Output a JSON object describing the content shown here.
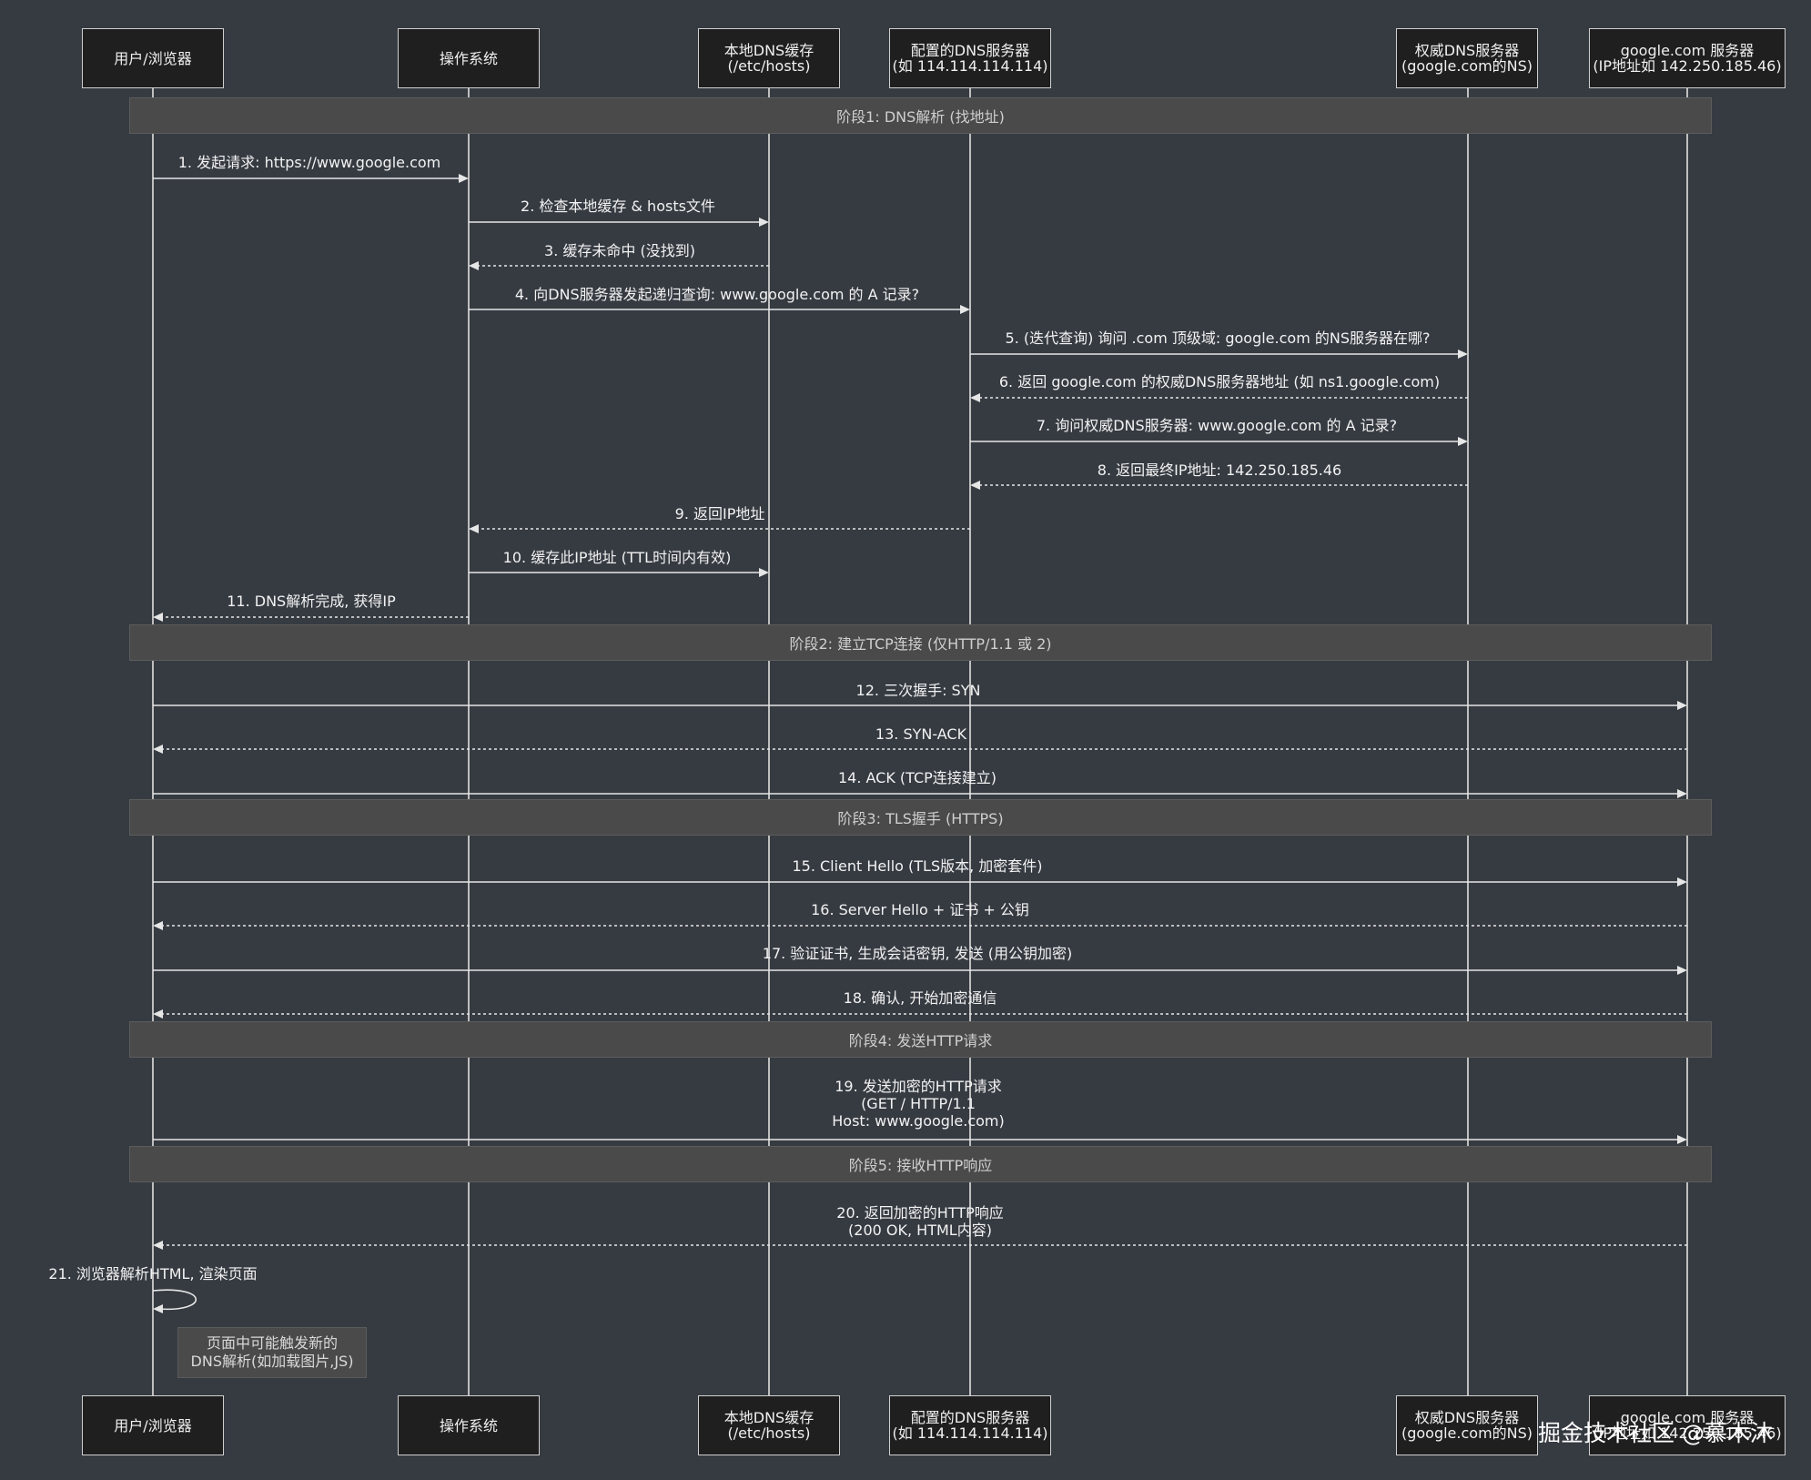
{
  "participants": [
    {
      "id": "user",
      "label": "用户/浏览器"
    },
    {
      "id": "os",
      "label": "操作系统"
    },
    {
      "id": "local",
      "label": "本地DNS缓存\n(/etc/hosts)"
    },
    {
      "id": "dns",
      "label": "配置的DNS服务器\n(如 114.114.114.114)"
    },
    {
      "id": "auth",
      "label": "权威DNS服务器\n(google.com的NS)"
    },
    {
      "id": "google",
      "label": "google.com 服务器\n(IP地址如 142.250.185.46)"
    }
  ],
  "phases": [
    {
      "label": "阶段1: DNS解析 (找地址)"
    },
    {
      "label": "阶段2: 建立TCP连接 (仅HTTP/1.1 或 2)"
    },
    {
      "label": "阶段3: TLS握手 (HTTPS)"
    },
    {
      "label": "阶段4: 发送HTTP请求"
    },
    {
      "label": "阶段5: 接收HTTP响应"
    }
  ],
  "messages": [
    {
      "label": "1. 发起请求: https://www.google.com",
      "from": "user",
      "to": "os",
      "dashed": false
    },
    {
      "label": "2. 检查本地缓存 & hosts文件",
      "from": "os",
      "to": "local",
      "dashed": false
    },
    {
      "label": "3. 缓存未命中 (没找到)",
      "from": "local",
      "to": "os",
      "dashed": true
    },
    {
      "label": "4. 向DNS服务器发起递归查询: www.google.com 的 A 记录?",
      "from": "os",
      "to": "dns",
      "dashed": false
    },
    {
      "label": "5. (迭代查询) 询问 .com 顶级域: google.com 的NS服务器在哪?",
      "from": "dns",
      "to": "auth",
      "dashed": false
    },
    {
      "label": "6. 返回 google.com 的权威DNS服务器地址 (如 ns1.google.com)",
      "from": "auth",
      "to": "dns",
      "dashed": true
    },
    {
      "label": "7. 询问权威DNS服务器: www.google.com 的 A 记录?",
      "from": "dns",
      "to": "auth",
      "dashed": false
    },
    {
      "label": "8. 返回最终IP地址: 142.250.185.46",
      "from": "auth",
      "to": "dns",
      "dashed": true
    },
    {
      "label": "9. 返回IP地址",
      "from": "dns",
      "to": "os",
      "dashed": true
    },
    {
      "label": "10. 缓存此IP地址 (TTL时间内有效)",
      "from": "os",
      "to": "local",
      "dashed": false
    },
    {
      "label": "11. DNS解析完成, 获得IP",
      "from": "os",
      "to": "user",
      "dashed": true
    },
    {
      "label": "12. 三次握手: SYN",
      "from": "user",
      "to": "google",
      "dashed": false
    },
    {
      "label": "13. SYN-ACK",
      "from": "google",
      "to": "user",
      "dashed": true
    },
    {
      "label": "14. ACK (TCP连接建立)",
      "from": "user",
      "to": "google",
      "dashed": false
    },
    {
      "label": "15. Client Hello (TLS版本, 加密套件)",
      "from": "user",
      "to": "google",
      "dashed": false
    },
    {
      "label": "16. Server Hello + 证书 + 公钥",
      "from": "google",
      "to": "user",
      "dashed": true
    },
    {
      "label": "17. 验证证书, 生成会话密钥, 发送 (用公钥加密)",
      "from": "user",
      "to": "google",
      "dashed": false
    },
    {
      "label": "18. 确认, 开始加密通信",
      "from": "google",
      "to": "user",
      "dashed": true
    },
    {
      "label": "19. 发送加密的HTTP请求\n(GET / HTTP/1.1\nHost: www.google.com)",
      "from": "user",
      "to": "google",
      "dashed": false
    },
    {
      "label": "20. 返回加密的HTTP响应\n(200 OK, HTML内容)",
      "from": "google",
      "to": "user",
      "dashed": true
    },
    {
      "label": "21. 浏览器解析HTML, 渲染页面",
      "from": "user",
      "to": "user",
      "dashed": false
    }
  ],
  "note": {
    "label": "页面中可能触发新的\nDNS解析(如加载图片,JS)"
  },
  "watermark": "掘金技术社区 @慕木沐"
}
